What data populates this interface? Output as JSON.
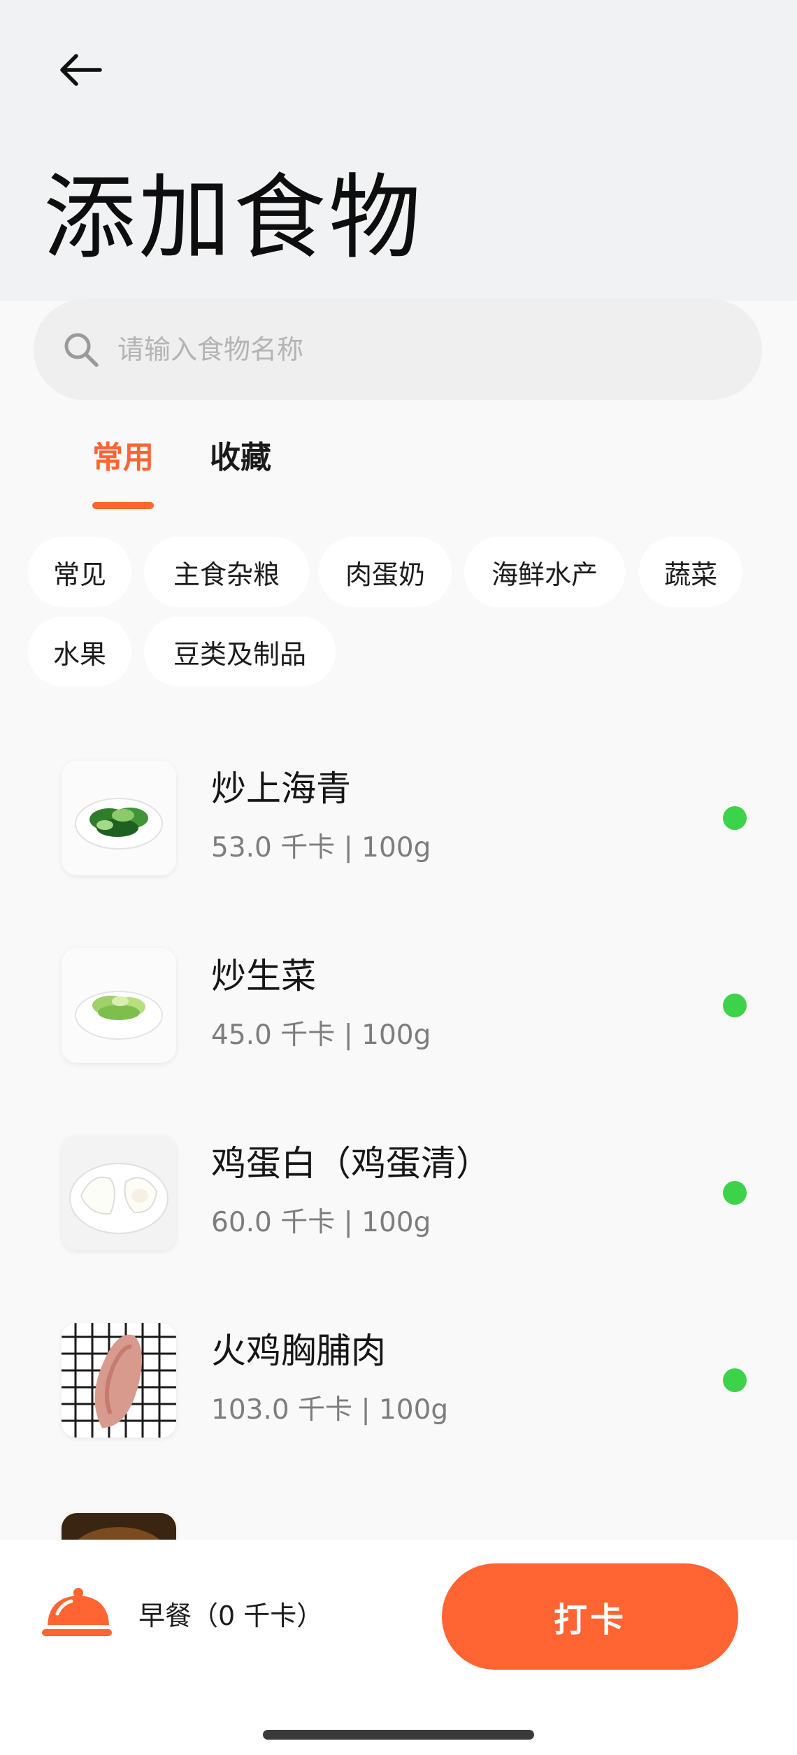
{
  "header": {
    "title": "添加食物"
  },
  "search": {
    "placeholder": "请输入食物名称"
  },
  "tabs": [
    {
      "label": "常用",
      "active": true
    },
    {
      "label": "收藏",
      "active": false
    }
  ],
  "categories": [
    "常见",
    "主食杂粮",
    "肉蛋奶",
    "海鲜水产",
    "蔬菜",
    "水果",
    "豆类及制品"
  ],
  "foods": [
    {
      "name": "炒上海青",
      "meta": "53.0 千卡 | 100g",
      "status_color": "#3cd34b"
    },
    {
      "name": "炒生菜",
      "meta": "45.0 千卡 | 100g",
      "status_color": "#3cd34b"
    },
    {
      "name": "鸡蛋白（鸡蛋清）",
      "meta": "60.0 千卡 | 100g",
      "status_color": "#3cd34b"
    },
    {
      "name": "火鸡胸脯肉",
      "meta": "103.0 千卡 | 100g",
      "status_color": "#3cd34b"
    }
  ],
  "bottom": {
    "meal_label": "早餐（0 千卡）",
    "checkin_label": "打卡",
    "icon": "serving-cloche-icon"
  },
  "colors": {
    "accent": "#ff6432",
    "status_green": "#3cd34b"
  }
}
